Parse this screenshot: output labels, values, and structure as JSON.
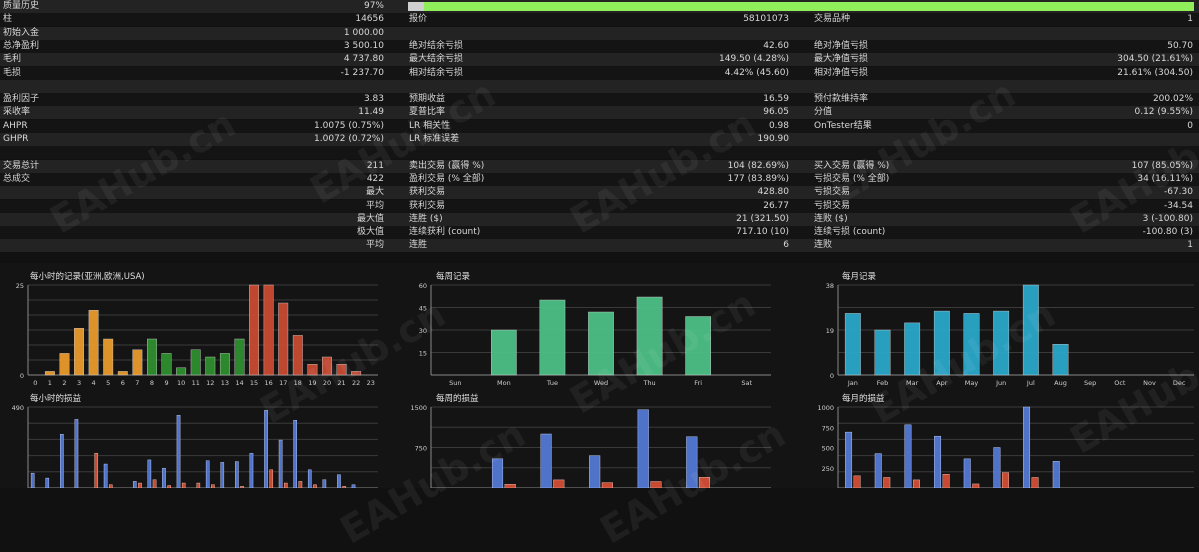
{
  "stats": [
    {
      "l1": "质量历史",
      "v1": "97%",
      "quality_fraction": 0.02
    },
    {
      "l1": "柱",
      "v1": "14656",
      "l2": "报价",
      "v2": "58101073",
      "l3": "交易品种",
      "v3": "1"
    },
    {
      "l1": "初始入金",
      "v1": "1 000.00"
    },
    {
      "l1": "总净盈利",
      "v1": "3 500.10",
      "l2": "绝对结余亏损",
      "v2": "42.60",
      "l3": "绝对净值亏损",
      "v3": "50.70"
    },
    {
      "l1": "毛利",
      "v1": "4 737.80",
      "l2": "最大结余亏损",
      "v2": "149.50 (4.28%)",
      "l3": "最大净值亏损",
      "v3": "304.50 (21.61%)"
    },
    {
      "l1": "毛损",
      "v1": "-1 237.70",
      "l2": "相对结余亏损",
      "v2": "4.42% (45.60)",
      "l3": "相对净值亏损",
      "v3": "21.61% (304.50)"
    },
    {},
    {
      "l1": "盈利因子",
      "v1": "3.83",
      "l2": "预期收益",
      "v2": "16.59",
      "l3": "预付款维持率",
      "v3": "200.02%"
    },
    {
      "l1": "采收率",
      "v1": "11.49",
      "l2": "夏普比率",
      "v2": "96.05",
      "l3": "分值",
      "v3": "0.12 (9.55%)"
    },
    {
      "l1": "AHPR",
      "v1": "1.0075 (0.75%)",
      "l2": "LR 相关性",
      "v2": "0.98",
      "l3": "OnTester结果",
      "v3": "0"
    },
    {
      "l1": "GHPR",
      "v1": "1.0072 (0.72%)",
      "l2": "LR 标准误差",
      "v2": "190.90"
    },
    {},
    {
      "l1": "交易总计",
      "v1": "211",
      "l2": "卖出交易 (赢得 %)",
      "v2": "104 (82.69%)",
      "l3": "买入交易 (赢得 %)",
      "v3": "107 (85.05%)"
    },
    {
      "l1": "总成交",
      "v1": "422",
      "l2": "盈利交易 (% 全部)",
      "v2": "177 (83.89%)",
      "l3": "亏损交易 (% 全部)",
      "v3": "34 (16.11%)"
    },
    {
      "r1": "最大",
      "l2": "获利交易",
      "v2": "428.80",
      "l3": "亏损交易",
      "v3": "-67.30"
    },
    {
      "r1": "平均",
      "l2": "获利交易",
      "v2": "26.77",
      "l3": "亏损交易",
      "v3": "-34.54"
    },
    {
      "r1": "最大值",
      "l2": "连胜 ($)",
      "v2": "21 (321.50)",
      "l3": "连败 ($)",
      "v3": "3 (-100.80)"
    },
    {
      "r1": "极大值",
      "l2": "连续获利 (count)",
      "v2": "717.10 (10)",
      "l3": "连续亏损 (count)",
      "v3": "-100.80 (3)"
    },
    {
      "r1": "平均",
      "l2": "连胜",
      "v2": "6",
      "l3": "连败",
      "v3": "1"
    }
  ],
  "watermark": "EAHub.cn",
  "colors": {
    "bg": "#141414",
    "grid": "#3a3a3a",
    "axis": "#888888",
    "orange": "#e89a2c",
    "green": "#2f8f2f",
    "red": "#c84a32",
    "teal_green": "#4cbf86",
    "cyan": "#2aa7c9",
    "blue": "#4f73c9",
    "pnl_red": "#c84a32"
  },
  "chart_data": [
    {
      "type": "bar",
      "title": "每小时的记录(亚洲,欧洲,USA)",
      "categories": [
        "0",
        "1",
        "2",
        "3",
        "4",
        "5",
        "6",
        "7",
        "8",
        "9",
        "10",
        "11",
        "12",
        "13",
        "14",
        "15",
        "16",
        "17",
        "18",
        "19",
        "20",
        "21",
        "22",
        "23"
      ],
      "values": [
        0,
        1,
        6,
        13,
        18,
        10,
        1,
        7,
        10,
        6,
        2,
        7,
        5,
        6,
        10,
        25,
        25,
        20,
        11,
        3,
        5,
        3,
        1,
        0
      ],
      "colors": [
        "orange",
        "orange",
        "orange",
        "orange",
        "orange",
        "orange",
        "orange",
        "orange",
        "green",
        "green",
        "green",
        "green",
        "green",
        "green",
        "green",
        "red",
        "red",
        "red",
        "red",
        "red",
        "red",
        "red",
        "red",
        "red"
      ],
      "ylim": [
        0,
        25
      ],
      "yticks": [
        "0",
        "25"
      ]
    },
    {
      "type": "bar",
      "title": "每周记录",
      "categories": [
        "Sun",
        "Mon",
        "Tue",
        "Wed",
        "Thu",
        "Fri",
        "Sat"
      ],
      "values": [
        0,
        30,
        50,
        42,
        52,
        39,
        0
      ],
      "ylim": [
        0,
        60
      ],
      "yticks": [
        "15",
        "30",
        "45",
        "60"
      ]
    },
    {
      "type": "bar",
      "title": "每月记录",
      "categories": [
        "Jan",
        "Feb",
        "Mar",
        "Apr",
        "May",
        "Jun",
        "Jul",
        "Aug",
        "Sep",
        "Oct",
        "Nov",
        "Dec"
      ],
      "values": [
        26,
        19,
        22,
        27,
        26,
        27,
        38,
        13,
        0,
        0,
        0,
        0
      ],
      "ylim": [
        0,
        38
      ],
      "yticks": [
        "0",
        "19",
        "38"
      ]
    },
    {
      "type": "bar",
      "title": "每小时的损益",
      "categories": [
        "0",
        "1",
        "2",
        "3",
        "4",
        "5",
        "6",
        "7",
        "8",
        "9",
        "10",
        "11",
        "12",
        "13",
        "14",
        "15",
        "16",
        "17",
        "18",
        "19",
        "20",
        "21",
        "22",
        "23"
      ],
      "series": [
        {
          "values": [
            90,
            60,
            325,
            415,
            0,
            145,
            0,
            40,
            170,
            120,
            440,
            0,
            165,
            155,
            160,
            210,
            470,
            290,
            410,
            110,
            50,
            80,
            20,
            0
          ]
        },
        {
          "values": [
            0,
            0,
            0,
            0,
            210,
            20,
            0,
            30,
            50,
            15,
            30,
            30,
            20,
            0,
            10,
            0,
            110,
            30,
            40,
            20,
            0,
            10,
            0,
            0
          ]
        }
      ],
      "ylim": [
        0,
        490
      ],
      "yticks": [
        "490"
      ]
    },
    {
      "type": "bar",
      "title": "每周的损益",
      "categories": [
        "Sun",
        "Mon",
        "Tue",
        "Wed",
        "Thu",
        "Fri",
        "Sat"
      ],
      "series": [
        {
          "values": [
            0,
            540,
            1000,
            600,
            1450,
            950,
            0
          ]
        },
        {
          "values": [
            0,
            70,
            150,
            100,
            120,
            200,
            0
          ]
        }
      ],
      "ylim": [
        0,
        1500
      ],
      "yticks": [
        "750",
        "1500"
      ]
    },
    {
      "type": "bar",
      "title": "每月的损益",
      "categories": [
        "Jan",
        "Feb",
        "Mar",
        "Apr",
        "May",
        "Jun",
        "Jul",
        "Aug",
        "Sep",
        "Oct",
        "Nov",
        "Dec"
      ],
      "series": [
        {
          "values": [
            690,
            425,
            780,
            640,
            360,
            500,
            1000,
            330,
            0,
            0,
            0,
            0
          ]
        },
        {
          "values": [
            150,
            130,
            100,
            170,
            50,
            190,
            130,
            0,
            0,
            0,
            0,
            0
          ]
        }
      ],
      "ylim": [
        0,
        1000
      ],
      "yticks": [
        "250",
        "500",
        "750",
        "1000"
      ]
    }
  ]
}
